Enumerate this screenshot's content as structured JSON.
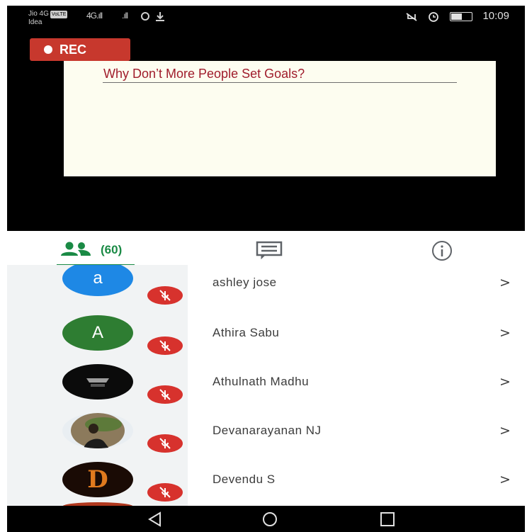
{
  "status_bar": {
    "carrier_line1": "Jio 4G",
    "carrier_badge": "VoLTE",
    "carrier_line2": "Idea",
    "signal_1": "4G.ıll",
    "signal_2": ".ıll",
    "time": "10:09"
  },
  "recording": {
    "label": "REC"
  },
  "slide": {
    "title": "Why Don’t More People Set Goals?"
  },
  "tabs": {
    "people_count": "(60)",
    "active_tab": "people"
  },
  "participants": [
    {
      "initial": "a",
      "name": "ashley jose",
      "avatar_color": "#1e88e5",
      "muted": true
    },
    {
      "initial": "A",
      "name": "Athira Sabu",
      "avatar_color": "#2e7d32",
      "muted": true
    },
    {
      "initial": "",
      "name": "Athulnath Madhu",
      "avatar_color": "#0b0b0b",
      "muted": true
    },
    {
      "initial": "",
      "name": "Devanarayanan NJ",
      "avatar_color": "#7a6a55",
      "muted": true
    },
    {
      "initial": "D",
      "name": "Devendu S",
      "avatar_color": "#1a0b05",
      "muted": true
    }
  ],
  "chevron": ">",
  "colors": {
    "accent_green": "#1a8a45",
    "rec_red": "#c7382d",
    "mute_red": "#d7322d",
    "slide_title": "#a01c2b"
  }
}
